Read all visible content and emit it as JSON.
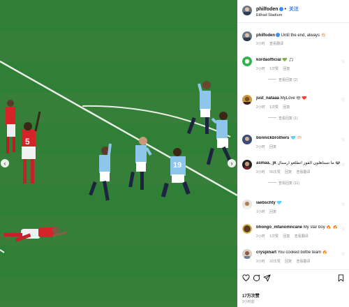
{
  "post": {
    "username": "philfoden",
    "follow_label": "关注",
    "location": "Etihad Stadium",
    "caption_user": "philfoden",
    "caption_text": "Until the end, always 👏🏻",
    "caption_time": "2小时",
    "caption_translate": "查看翻译"
  },
  "comments": [
    {
      "user": "kordaofficial",
      "text": "💚 🎵",
      "time": "2小时",
      "likes": "1次赞",
      "reply": "回复",
      "translate": "",
      "replies": "查看回复 (2)"
    },
    {
      "user": "just_nataaa",
      "text": "MyLove 😻 ❤️",
      "time": "2小时",
      "likes": "1次赞",
      "reply": "回复",
      "translate": "",
      "replies": "查看回复 (1)"
    },
    {
      "user": "bonnickbrothers",
      "text": "🩵 🫶🏻",
      "time": "2小时",
      "likes": "",
      "reply": "回复",
      "translate": "",
      "replies": ""
    },
    {
      "user": "asmaa._jk",
      "text": "ما تستاهلون الفوز انطلعو أرسنال 😂",
      "time": "2小时",
      "likes": "56次赞",
      "reply": "回复",
      "translate": "查看翻译",
      "replies": "查看回复 (11)"
    },
    {
      "user": "iaebschty",
      "text": "🩵",
      "time": "1小时",
      "likes": "",
      "reply": "回复",
      "translate": "",
      "replies": ""
    },
    {
      "user": "bhongo_mfanomncane",
      "text": "My star boy 🔥 🔥",
      "time": "2小时",
      "likes": "1次赞",
      "reply": "回复",
      "translate": "查看翻译",
      "replies": ""
    },
    {
      "user": "cryspinart",
      "text": "You cooked bottle team 🔥",
      "time": "2小时",
      "likes": "32次赞",
      "reply": "回复",
      "translate": "查看翻译",
      "replies": ""
    }
  ],
  "actions": {
    "like_icon": "heart-icon",
    "comment_icon": "comment-icon",
    "share_icon": "share-icon",
    "save_icon": "bookmark-icon",
    "likes_count": "17万次赞",
    "date": "2小时前"
  },
  "colors": {
    "accent": "#2b7ce9",
    "pitch": "#2f7f36",
    "city_kit": "#8ec5ea",
    "arsenal_kit": "#d4242a"
  }
}
